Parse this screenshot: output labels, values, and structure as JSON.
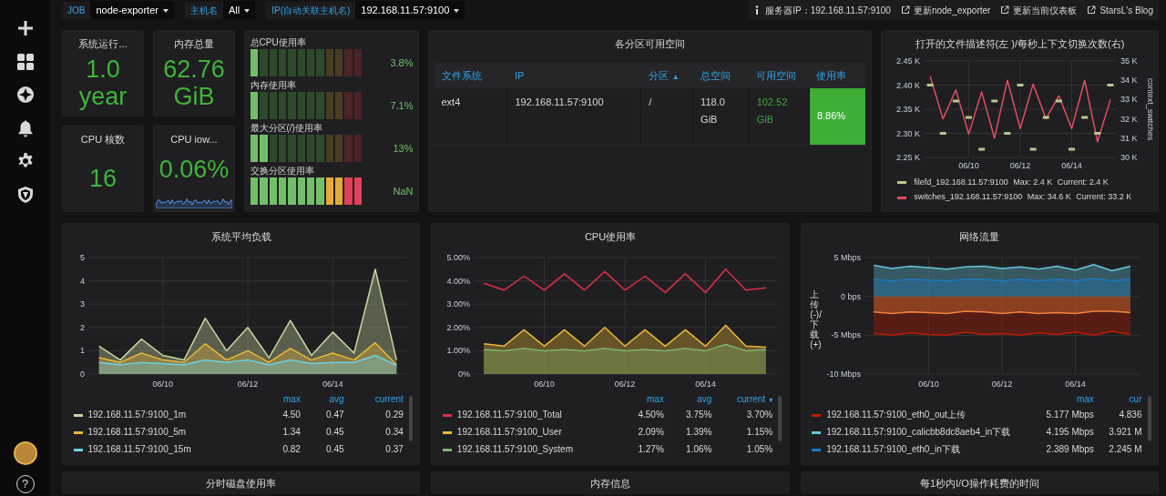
{
  "variables": [
    {
      "label": "JOB",
      "value": "node-exporter"
    },
    {
      "label": "主机名",
      "value": "All"
    },
    {
      "label": "IP(自动关联主机名)",
      "value": "192.168.11.57:9100"
    }
  ],
  "links": [
    {
      "kind": "info",
      "text": "服务器IP：192.168.11.57:9100"
    },
    {
      "kind": "link",
      "text": "更新node_exporter"
    },
    {
      "kind": "link",
      "text": "更新当前仪表板"
    },
    {
      "kind": "link",
      "text": "StarsL's Blog"
    }
  ],
  "stats": [
    {
      "title": "系统运行...",
      "value": "1.0 year"
    },
    {
      "title": "内存总量",
      "value": "62.76 GiB"
    },
    {
      "title": "CPU 核数",
      "value": "16"
    },
    {
      "title": "CPU iow...",
      "value": "0.06%",
      "sparkline": true
    }
  ],
  "gauges": [
    {
      "label": "总CPU使用率",
      "level": 0.083,
      "reading": "3.8%"
    },
    {
      "label": "内存使用率",
      "level": 0.083,
      "reading": "7.1%"
    },
    {
      "label": "最大分区(/)使用率",
      "level": 0.167,
      "reading": "13%"
    },
    {
      "label": "交换分区使用率",
      "level": 1,
      "reading": "NaN"
    }
  ],
  "partitions": {
    "title": "各分区可用空间",
    "columns": [
      {
        "label": "文件系统"
      },
      {
        "label": "IP"
      },
      {
        "label": "分区",
        "sort_caret": "▲"
      },
      {
        "label": "总空间"
      },
      {
        "label": "可用空间"
      },
      {
        "label": "使用率"
      }
    ],
    "rows": [
      {
        "cells": [
          "ext4",
          "192.168.11.57:9100",
          "/",
          "118.0 GiB",
          "102.52 GiB",
          "8.86%"
        ]
      }
    ]
  },
  "graphs": [
    {
      "title": "打开的文件描述符(左 )/每秒上下文切换次数(右)",
      "chart_data": {
        "type": "line",
        "grid": true,
        "categories": [
          null,
          null,
          null,
          "06/10",
          null,
          null,
          null,
          "06/12",
          null,
          null,
          null,
          "06/14",
          null,
          null,
          null
        ],
        "ylim": [
          2250,
          2450
        ],
        "yticks": [
          {
            "value": 2250,
            "label": "2.25 K"
          },
          {
            "value": 2300,
            "label": "2.30 K"
          },
          {
            "value": 2350,
            "label": "2.35 K"
          },
          {
            "value": 2400,
            "label": "2.40 K"
          },
          {
            "value": 2450,
            "label": "2.45 K"
          }
        ],
        "y2lim": [
          30000,
          35000
        ],
        "y2ticks": [
          {
            "value": 30000,
            "label": "30 K"
          },
          {
            "value": 31000,
            "label": "31 K"
          },
          {
            "value": 32000,
            "label": "32 K"
          },
          {
            "value": 33000,
            "label": "33 K"
          },
          {
            "value": 34000,
            "label": "34 K"
          },
          {
            "value": 35000,
            "label": "35 K"
          }
        ],
        "y2label": "context_switches",
        "series": [
          {
            "name": "filefd_192.168.11.57:9100",
            "color": "#b7c98a",
            "type": "scatter",
            "values": [
              2400,
              2300,
              2367,
              2333,
              2267,
              2367,
              2300,
              2400,
              2267,
              2333,
              2367,
              2267,
              2333,
              2300,
              2400
            ]
          },
          {
            "name": "switches_192.168.11.57:9100",
            "color": "#e24d62",
            "axis": "y2",
            "values": [
              34200,
              32000,
              33500,
              31200,
              33400,
              31000,
              34000,
              31500,
              33800,
              32000,
              33200,
              31500,
              34000,
              30800,
              33000
            ]
          }
        ]
      },
      "legend": {
        "rows": [
          {
            "values": [
              "Max: 2.4 K",
              "Current: 2.4 K"
            ]
          },
          {
            "values": [
              "Max: 34.6 K",
              "Current: 33.2 K"
            ]
          }
        ]
      }
    },
    {
      "title": "系统平均负载",
      "chart_data": {
        "type": "area",
        "grid": true,
        "categories": [
          null,
          null,
          null,
          "06/10",
          null,
          null,
          null,
          "06/12",
          null,
          null,
          null,
          "06/14",
          null,
          null,
          null
        ],
        "ylim": [
          0,
          5
        ],
        "yticks": [
          0,
          1,
          2,
          3,
          4,
          5
        ],
        "series": [
          {
            "name": "192.168.11.57:9100_1m",
            "color": "#c8d6a0",
            "values": [
              1.2,
              0.6,
              1.5,
              0.8,
              0.6,
              2.4,
              1.0,
              2.0,
              0.7,
              2.3,
              0.8,
              1.8,
              0.9,
              4.5,
              0.6
            ]
          },
          {
            "name": "192.168.11.57:9100_5m",
            "color": "#eab839",
            "values": [
              0.7,
              0.5,
              0.9,
              0.6,
              0.5,
              1.3,
              0.6,
              1.0,
              0.5,
              1.1,
              0.6,
              0.9,
              0.6,
              1.34,
              0.4
            ]
          },
          {
            "name": "192.168.11.57:9100_15m",
            "color": "#6ed0e0",
            "values": [
              0.5,
              0.4,
              0.5,
              0.45,
              0.4,
              0.6,
              0.5,
              0.6,
              0.4,
              0.6,
              0.45,
              0.5,
              0.5,
              0.8,
              0.37
            ]
          }
        ]
      },
      "legend": {
        "columns": [
          {
            "label": "max"
          },
          {
            "label": "avg"
          },
          {
            "label": "current"
          }
        ],
        "rows": [
          {
            "values": [
              "4.50",
              "0.47",
              "0.29"
            ]
          },
          {
            "values": [
              "1.34",
              "0.45",
              "0.34"
            ]
          },
          {
            "values": [
              "0.82",
              "0.45",
              "0.37"
            ]
          }
        ]
      }
    },
    {
      "title": "CPU使用率",
      "chart_data": {
        "type": "area",
        "grid": true,
        "categories": [
          null,
          null,
          null,
          "06/10",
          null,
          null,
          null,
          "06/12",
          null,
          null,
          null,
          "06/14",
          null,
          null,
          null
        ],
        "ylim": [
          0,
          5
        ],
        "yticks": [
          {
            "value": 0,
            "label": "0%"
          },
          {
            "value": 1,
            "label": "1.00%"
          },
          {
            "value": 2,
            "label": "2.00%"
          },
          {
            "value": 3,
            "label": "3.00%"
          },
          {
            "value": 4,
            "label": "4.00%"
          },
          {
            "value": 5,
            "label": "5.00%"
          }
        ],
        "series": [
          {
            "name": "192.168.11.57:9100_Total",
            "color": "#e02f44",
            "type": "line",
            "values": [
              3.9,
              3.6,
              4.2,
              3.6,
              4.3,
              3.6,
              4.4,
              3.6,
              4.2,
              3.5,
              4.3,
              3.5,
              4.5,
              3.6,
              3.7
            ]
          },
          {
            "name": "192.168.11.57:9100_User",
            "color": "#eab839",
            "values": [
              1.3,
              1.2,
              1.9,
              1.2,
              1.9,
              1.2,
              2.0,
              1.2,
              1.9,
              1.2,
              1.9,
              1.2,
              2.09,
              1.2,
              1.15
            ]
          },
          {
            "name": "192.168.11.57:9100_System",
            "color": "#7eb26d",
            "values": [
              1.05,
              1.0,
              1.1,
              1.0,
              1.05,
              1.0,
              1.1,
              1.0,
              1.05,
              1.0,
              1.1,
              1.0,
              1.27,
              1.0,
              1.05
            ]
          }
        ]
      },
      "legend": {
        "columns": [
          {
            "label": "max"
          },
          {
            "label": "avg"
          },
          {
            "label": "current",
            "sort_caret": "▾"
          }
        ],
        "rows": [
          {
            "values": [
              "4.50%",
              "3.75%",
              "3.70%"
            ]
          },
          {
            "values": [
              "2.09%",
              "1.39%",
              "1.15%"
            ]
          },
          {
            "values": [
              "1.27%",
              "1.06%",
              "1.05%"
            ]
          }
        ]
      }
    },
    {
      "title": "网络流量",
      "chart_data": {
        "type": "area",
        "grid": true,
        "ylabel": "上传(-)/下载(+)",
        "categories": [
          null,
          null,
          null,
          "06/10",
          null,
          null,
          null,
          "06/12",
          null,
          null,
          null,
          "06/14",
          null,
          null,
          null
        ],
        "ylim": [
          -10,
          5
        ],
        "yticks": [
          {
            "value": -10,
            "label": "-10 Mbps"
          },
          {
            "value": -5,
            "label": "-5 Mbps"
          },
          {
            "value": 0,
            "label": "0 bps"
          },
          {
            "value": 5,
            "label": "5 Mbps"
          }
        ],
        "series": [
          {
            "name": "192.168.11.57:9100_eth0_out上传",
            "color": "#bf1b00",
            "values": [
              -4.8,
              -5.0,
              -4.7,
              -4.9,
              -5.0,
              -4.6,
              -4.9,
              -4.8,
              -5.0,
              -4.7,
              -4.9,
              -4.6,
              -5.0,
              -4.5,
              -4.9
            ]
          },
          {
            "name": "192.168.11.57:9100_calicbb8dc8aeb4_in下载",
            "color": "#65c5db",
            "values": [
              4.0,
              3.6,
              3.9,
              3.7,
              3.5,
              3.8,
              3.9,
              3.6,
              3.8,
              3.5,
              3.9,
              3.4,
              4.1,
              3.3,
              3.9
            ]
          },
          {
            "name": "192.168.11.57:9100_eth0_in下载",
            "color": "#1f78c1",
            "values": [
              2.2,
              2.0,
              2.2,
              2.1,
              2.0,
              2.2,
              2.2,
              2.0,
              2.2,
              2.0,
              2.2,
              2.0,
              2.3,
              2.0,
              2.2
            ]
          },
          {
            "color": "#ef843c",
            "values": [
              -2.0,
              -2.2,
              -2.0,
              -2.1,
              -2.2,
              -1.9,
              -2.0,
              -2.2,
              -2.0,
              -2.2,
              -2.1,
              -2.2,
              -1.9,
              -1.9,
              -2.1
            ]
          }
        ]
      },
      "legend": {
        "columns": [
          {
            "label": "max"
          },
          {
            "label": "cur"
          }
        ],
        "rows": [
          {
            "values": [
              "5.177 Mbps",
              "4.836"
            ]
          },
          {
            "values": [
              "4.195 Mbps",
              "3.921 M"
            ]
          },
          {
            "values": [
              "2.389 Mbps",
              "2.245 M"
            ]
          }
        ]
      }
    }
  ],
  "lower_panels": [
    {
      "title": "分时磁盘使用率"
    },
    {
      "title": "内存信息"
    },
    {
      "title": "每1秒内I/O操作耗费的时间"
    }
  ],
  "help": "?"
}
